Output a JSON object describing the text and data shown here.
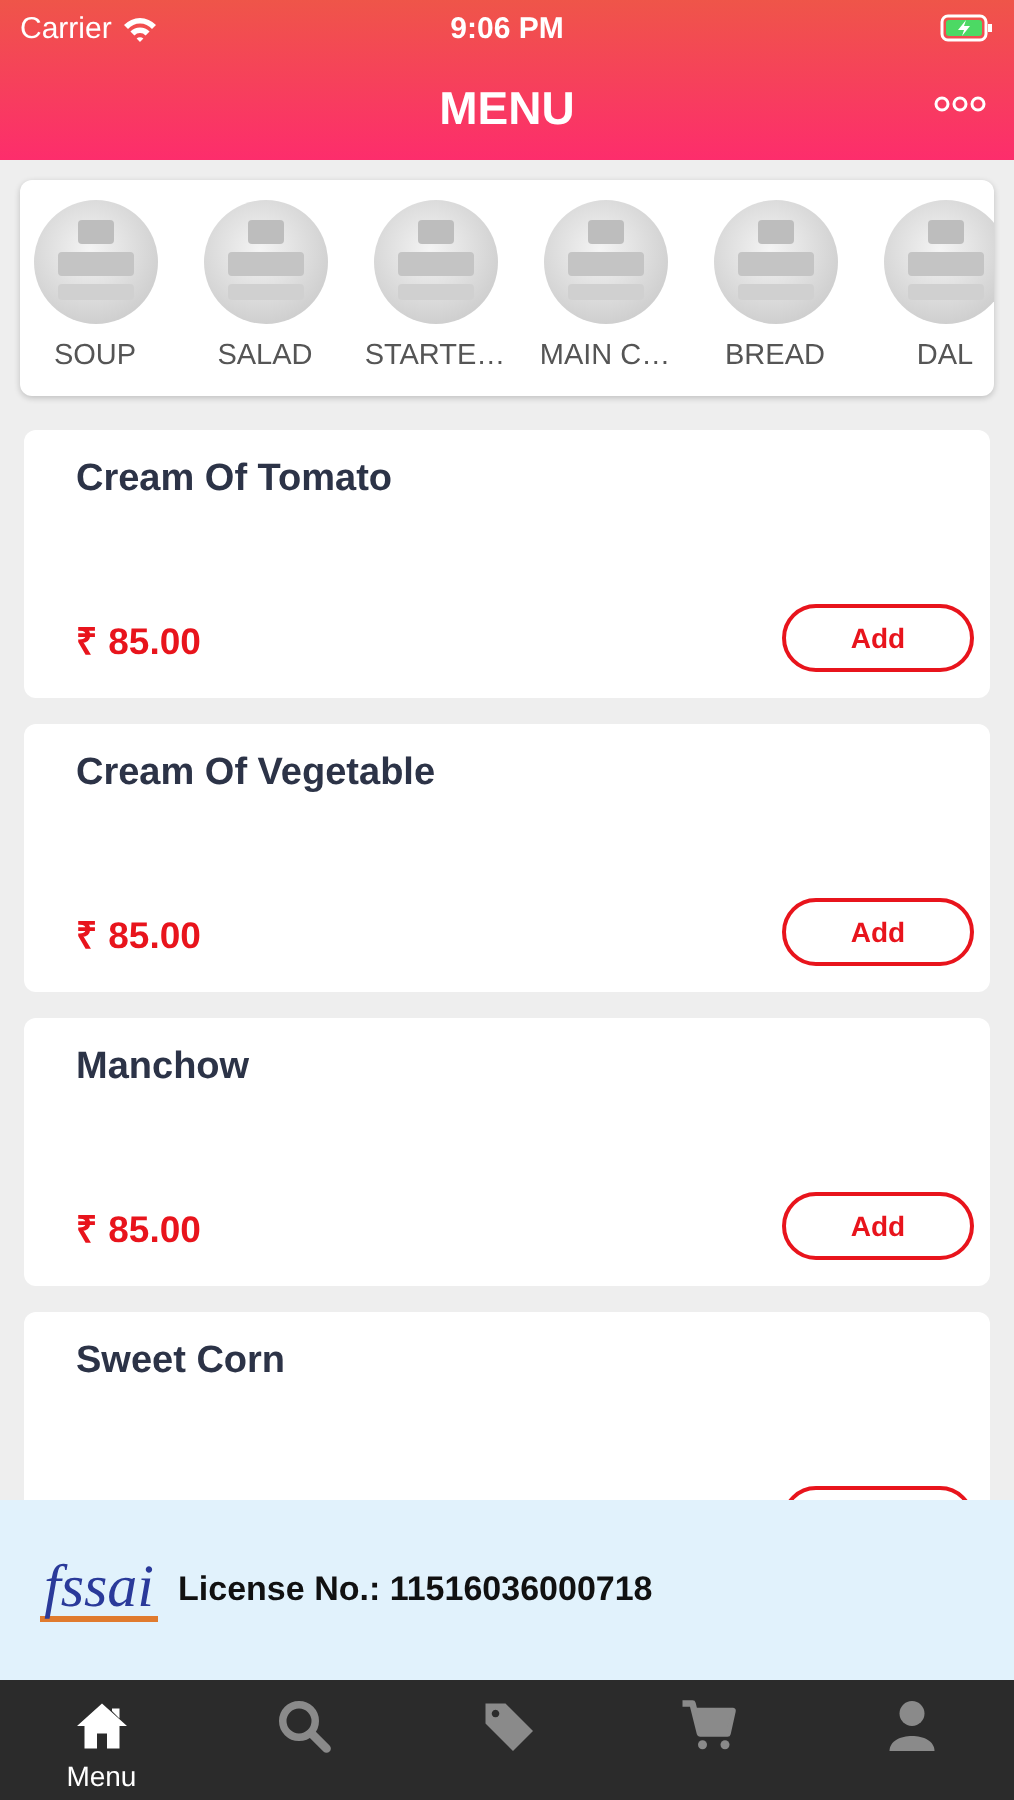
{
  "status_bar": {
    "carrier": "Carrier",
    "time": "9:06 PM"
  },
  "header": {
    "title": "MENU"
  },
  "categories": [
    {
      "label": "SOUP"
    },
    {
      "label": "SALAD"
    },
    {
      "label": "STARTE…"
    },
    {
      "label": "MAIN C…"
    },
    {
      "label": "BREAD"
    },
    {
      "label": "DAL"
    }
  ],
  "items": [
    {
      "name": "Cream Of Tomato",
      "price": "₹ 85.00",
      "button": "Add"
    },
    {
      "name": "Cream Of Vegetable",
      "price": "₹ 85.00",
      "button": "Add"
    },
    {
      "name": "Manchow",
      "price": "₹ 85.00",
      "button": "Add"
    },
    {
      "name": "Sweet Corn"
    }
  ],
  "license": {
    "logo": "fssai",
    "text": "License No.: 11516036000718"
  },
  "tab_bar": [
    {
      "kind": "home",
      "label": "Menu",
      "selected": true
    },
    {
      "kind": "search",
      "selected": false
    },
    {
      "kind": "offers",
      "selected": false
    },
    {
      "kind": "cart",
      "selected": false
    },
    {
      "kind": "profile",
      "selected": false
    }
  ]
}
